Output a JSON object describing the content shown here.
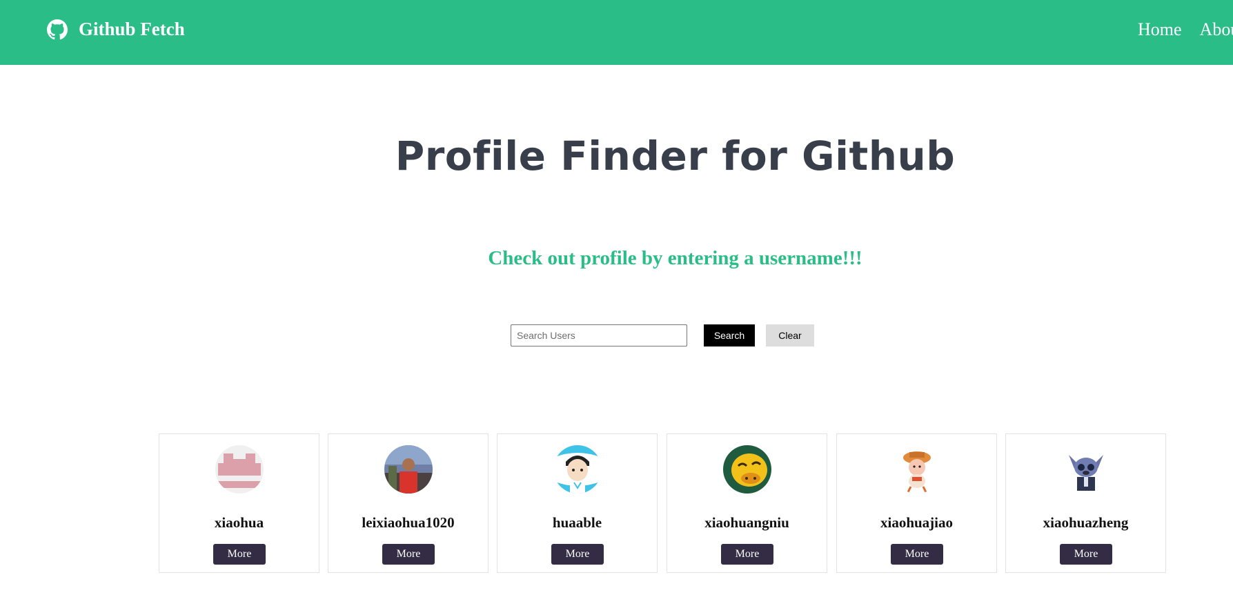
{
  "navbar": {
    "brand": "Github Fetch",
    "brand_icon": "github-icon",
    "links": [
      "Home",
      "About"
    ]
  },
  "hero": {
    "title": "Profile Finder for Github",
    "subtitle": "Check out profile by entering a username!!!"
  },
  "search": {
    "placeholder": "Search Users",
    "value": "",
    "search_label": "Search",
    "clear_label": "Clear"
  },
  "users": [
    {
      "username": "xiaohua",
      "more_label": "More"
    },
    {
      "username": "leixiaohua1020",
      "more_label": "More"
    },
    {
      "username": "huaable",
      "more_label": "More"
    },
    {
      "username": "xiaohuangniu",
      "more_label": "More"
    },
    {
      "username": "xiaohuajiao",
      "more_label": "More"
    },
    {
      "username": "xiaohuazheng",
      "more_label": "More"
    }
  ],
  "colors": {
    "navbar": "#2abd88",
    "title": "#393e4b",
    "subtitle": "#2abd88",
    "search_button": "#000000",
    "clear_button": "#dddddd",
    "more_button": "#332c44"
  }
}
